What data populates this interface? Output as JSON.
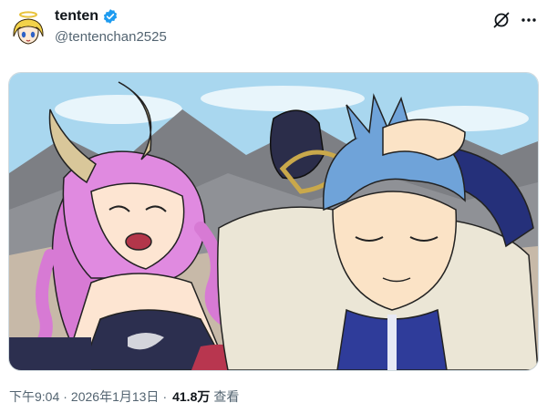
{
  "post": {
    "author": {
      "display_name": "tenten",
      "handle": "@tentenchan2525",
      "verified": true,
      "verified_color": "#1d9bf0"
    },
    "icons": {
      "grok": "grok-slash-icon",
      "more": "more-dots-icon"
    },
    "media": {
      "type": "illustration"
    },
    "meta": {
      "time": "下午9:04",
      "separator": "·",
      "date": "2026年1月13日",
      "views_count": "41.8万",
      "views_label": "查看"
    }
  }
}
